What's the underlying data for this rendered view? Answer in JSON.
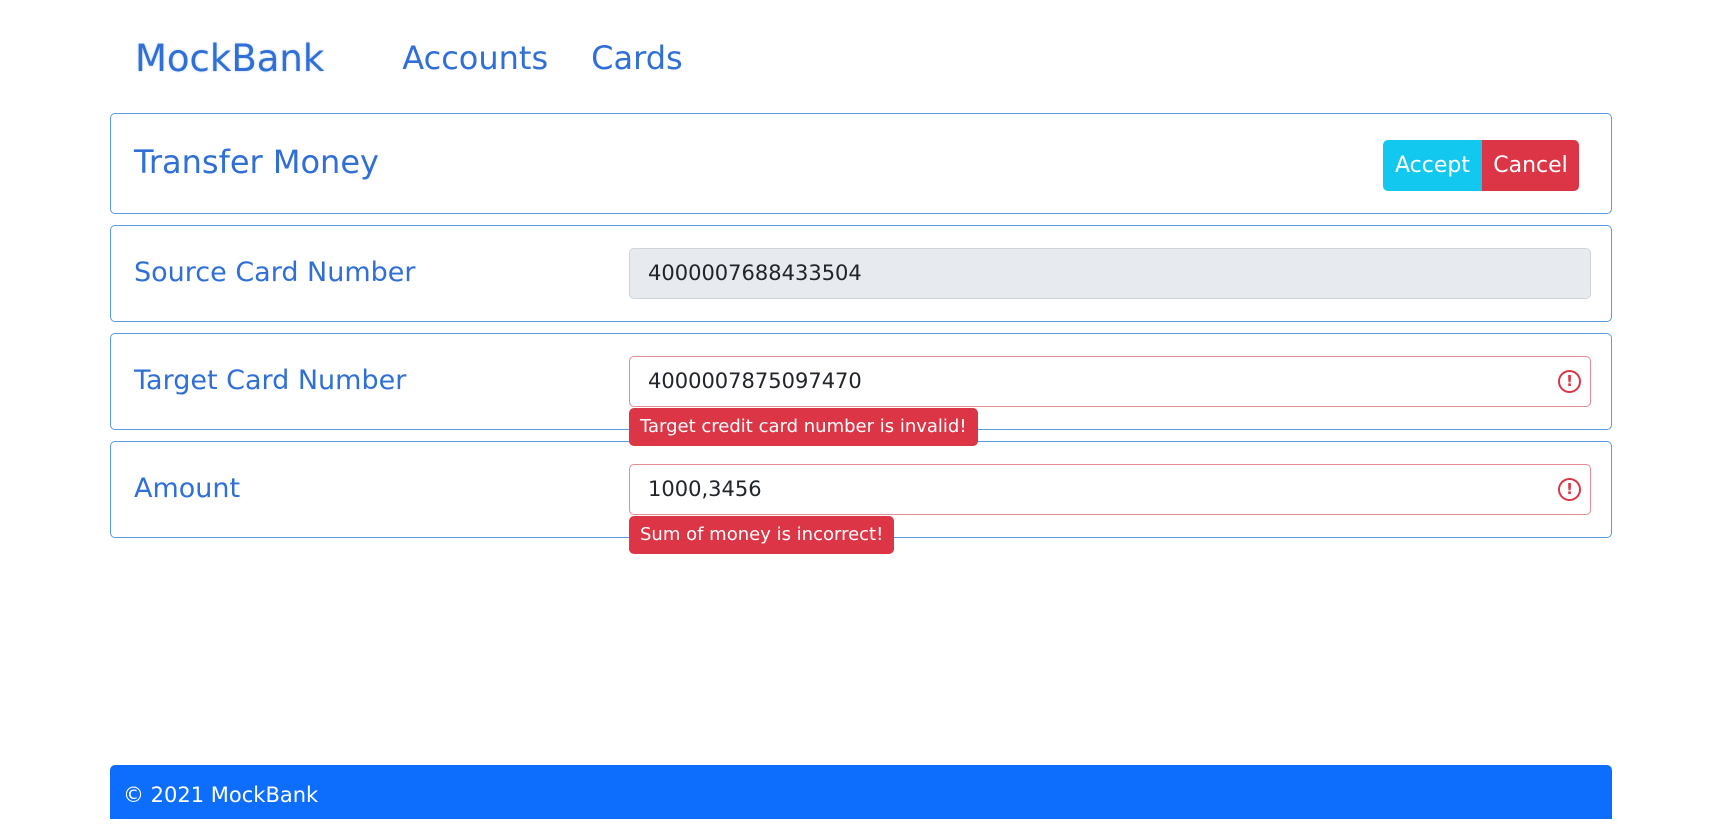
{
  "navbar": {
    "brand": "MockBank",
    "links": [
      "Accounts",
      "Cards"
    ]
  },
  "header": {
    "title": "Transfer Money",
    "accept_label": "Accept",
    "cancel_label": "Cancel"
  },
  "form": {
    "source": {
      "label": "Source Card Number",
      "value": "4000007688433504"
    },
    "target": {
      "label": "Target Card Number",
      "value": "4000007875097470",
      "error": "Target credit card number is invalid!"
    },
    "amount": {
      "label": "Amount",
      "value": "1000,3456",
      "error": "Sum of money is incorrect!"
    }
  },
  "footer": {
    "text": "© 2021 MockBank"
  },
  "colors": {
    "primary": "#0d6efd",
    "link": "#2f6fd6",
    "accept": "#13c8ef",
    "danger": "#dc3545"
  },
  "icons": {
    "invalid": "exclamation-circle-icon"
  }
}
